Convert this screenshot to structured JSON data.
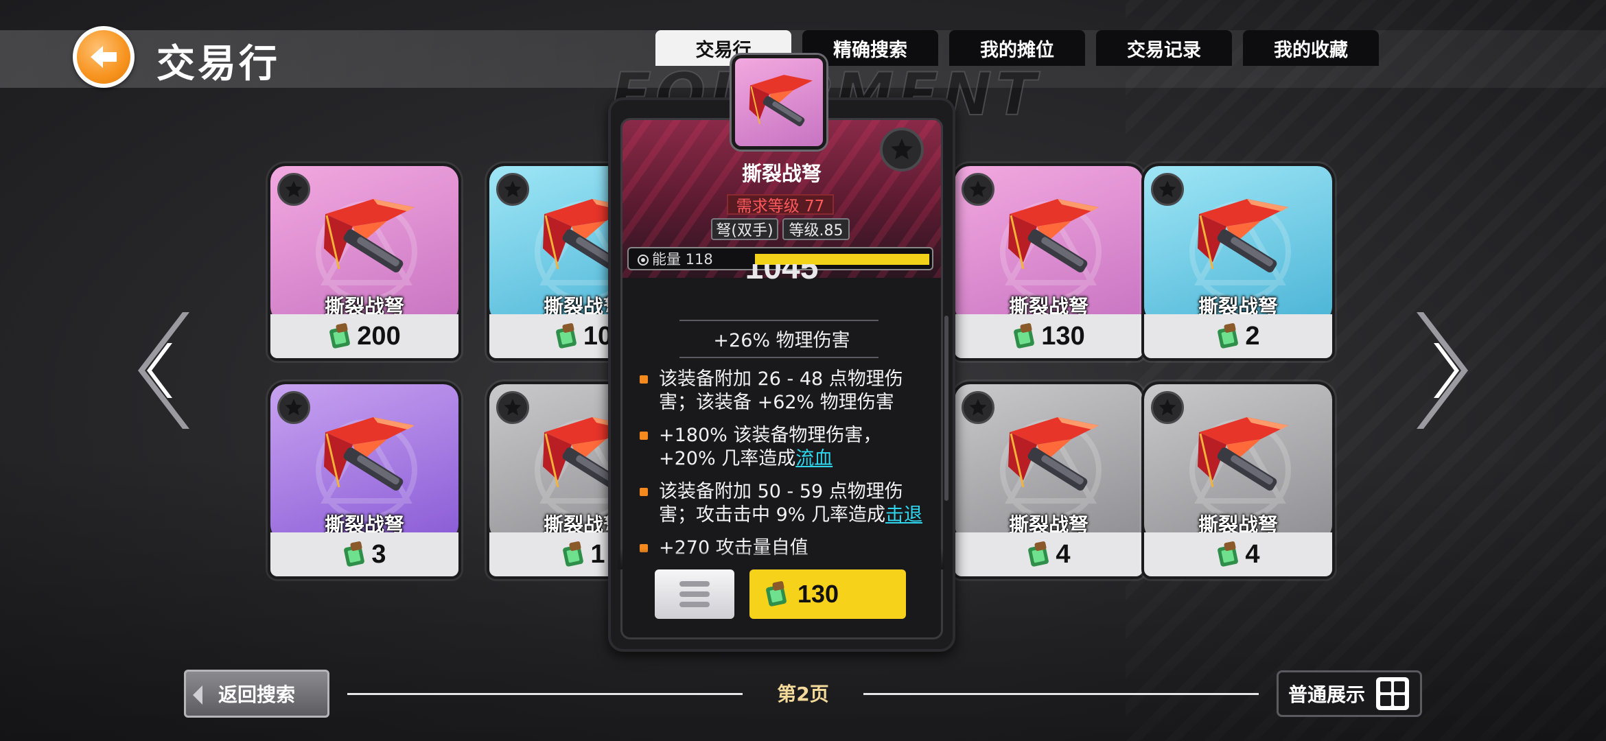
{
  "header": {
    "title": "交易行",
    "bg_word": "EQUIPMENT",
    "tabs": [
      {
        "label": "交易行",
        "active": true
      },
      {
        "label": "精确搜索"
      },
      {
        "label": "我的摊位"
      },
      {
        "label": "交易记录"
      },
      {
        "label": "我的收藏"
      }
    ]
  },
  "items": [
    {
      "name": "撕裂战弩",
      "price": "200",
      "rarity": "pink"
    },
    {
      "name": "撕裂战弩",
      "price": "10",
      "rarity": "cyan"
    },
    {
      "name": "撕裂战弩",
      "price": "130",
      "rarity": "pink"
    },
    {
      "name": "撕裂战弩",
      "price": "2",
      "rarity": "cyan"
    },
    {
      "name": "撕裂战弩",
      "price": "3",
      "rarity": "purple"
    },
    {
      "name": "撕裂战弩",
      "price": "1",
      "rarity": "gray"
    },
    {
      "name": "撕裂战弩",
      "price": "4",
      "rarity": "gray"
    },
    {
      "name": "撕裂战弩",
      "price": "4",
      "rarity": "gray"
    }
  ],
  "popup": {
    "name": "撕裂战弩",
    "required_level": "需求等级 77",
    "weapon_type": "弩(双手)",
    "item_level": "等级.85",
    "energy_label": "能量 118",
    "energy_fill_ratio": 1.0,
    "power": "1045",
    "main_stat": "+26% 物理伤害",
    "affixes": [
      {
        "text": "该装备附加 26 - 48 点物理伤害；该装备 +62% 物理伤害",
        "link": ""
      },
      {
        "text": "+180% 该装备物理伤害，+20% 几率造成",
        "link": "流血"
      },
      {
        "text": "该装备附加 50 - 59 点物理伤害；攻击击中 9% 几率造成",
        "link": "击退"
      },
      {
        "text": "+270 攻击量自值",
        "link": ""
      }
    ],
    "buy_price": "130"
  },
  "footer": {
    "return_label": "返回搜索",
    "page_label": "第2页",
    "display_label": "普通展示"
  },
  "colors": {
    "accent_yellow": "#f7d21b",
    "back_button_orange": "#f7931e",
    "rarity_pink": "#d98fd0",
    "rarity_cyan": "#6cc9e3",
    "rarity_purple": "#a27ae4",
    "rarity_gray": "#a9a9ad",
    "required_level_red": "#ff5a5a",
    "link_cyan": "#2fd6f0"
  },
  "icons": [
    "back-arrow-icon",
    "star-icon",
    "crossbow-icon",
    "gem-currency-icon",
    "chevron-left-icon",
    "chevron-right-icon",
    "menu-icon",
    "grid-icon",
    "energy-icon"
  ]
}
